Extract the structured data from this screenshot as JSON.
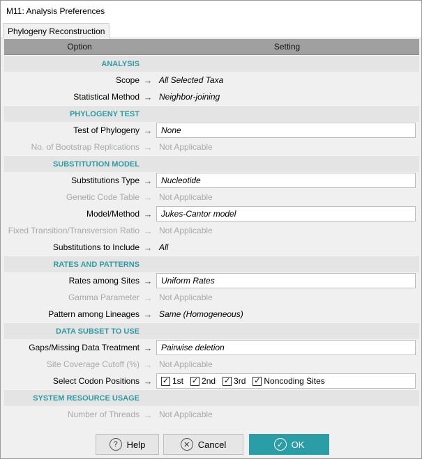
{
  "window": {
    "title": "M11: Analysis Preferences"
  },
  "tab": {
    "label": "Phylogeny Reconstruction"
  },
  "grid": {
    "option_header": "Option",
    "setting_header": "Setting"
  },
  "sections": {
    "analysis": "ANALYSIS",
    "phylogeny_test": "PHYLOGENY TEST",
    "substitution_model": "SUBSTITUTION MODEL",
    "rates_and_patterns": "RATES AND PATTERNS",
    "data_subset": "DATA SUBSET TO USE",
    "system_resource": "SYSTEM RESOURCE USAGE"
  },
  "rows": {
    "scope": {
      "label": "Scope",
      "value": "All Selected Taxa"
    },
    "statistical_method": {
      "label": "Statistical Method",
      "value": "Neighbor-joining"
    },
    "test_of_phylogeny": {
      "label": "Test of Phylogeny",
      "value": "None"
    },
    "bootstrap": {
      "label": "No. of Bootstrap Replications",
      "value": "Not Applicable"
    },
    "substitutions_type": {
      "label": "Substitutions Type",
      "value": "Nucleotide"
    },
    "genetic_code": {
      "label": "Genetic Code Table",
      "value": "Not Applicable"
    },
    "model_method": {
      "label": "Model/Method",
      "value": "Jukes-Cantor model"
    },
    "fixed_ratio": {
      "label": "Fixed Transition/Transversion Ratio",
      "value": "Not Applicable"
    },
    "subs_to_include": {
      "label": "Substitutions to Include",
      "value": "All"
    },
    "rates_among_sites": {
      "label": "Rates among Sites",
      "value": "Uniform Rates"
    },
    "gamma": {
      "label": "Gamma Parameter",
      "value": "Not Applicable"
    },
    "pattern_lineages": {
      "label": "Pattern among Lineages",
      "value": "Same (Homogeneous)"
    },
    "gaps": {
      "label": "Gaps/Missing Data Treatment",
      "value": "Pairwise deletion"
    },
    "site_coverage": {
      "label": "Site Coverage Cutoff (%)",
      "value": "Not Applicable"
    },
    "codon_positions": {
      "label": "Select Codon Positions",
      "options": [
        "1st",
        "2nd",
        "3rd",
        "Noncoding Sites"
      ]
    },
    "threads": {
      "label": "Number of Threads",
      "value": "Not Applicable"
    }
  },
  "buttons": {
    "help": "Help",
    "cancel": "Cancel",
    "ok": "OK"
  },
  "colors": {
    "accent": "#2a9da6",
    "section_title": "#2e9ba2",
    "header_bg": "#a0a0a0"
  }
}
